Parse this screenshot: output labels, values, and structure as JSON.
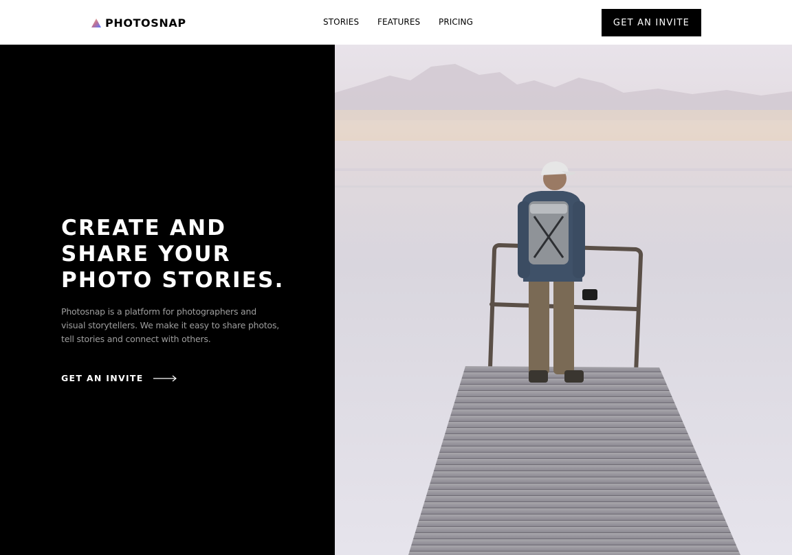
{
  "header": {
    "brand": "PHOTOSNAP",
    "nav": [
      "STORIES",
      "FEATURES",
      "PRICING"
    ],
    "cta_label": "GET AN INVITE"
  },
  "hero": {
    "title_lines": [
      "CREATE AND",
      "SHARE YOUR",
      "PHOTO STORIES."
    ],
    "description": "Photosnap is a platform for photographers and visual storytellers. We make it easy to share photos, tell stories and connect with others.",
    "link_label": "GET AN INVITE",
    "image_subject": "photographer-on-pier-photo"
  },
  "icons": {
    "logo": "photosnap-logo-icon",
    "arrow": "arrow-right-icon"
  },
  "colors": {
    "background": "#000000",
    "text_primary": "#ffffff",
    "text_muted": "#9e9e9e",
    "logo_gradient": [
      "#ffc593",
      "#bc7198",
      "#5a77ff"
    ]
  }
}
